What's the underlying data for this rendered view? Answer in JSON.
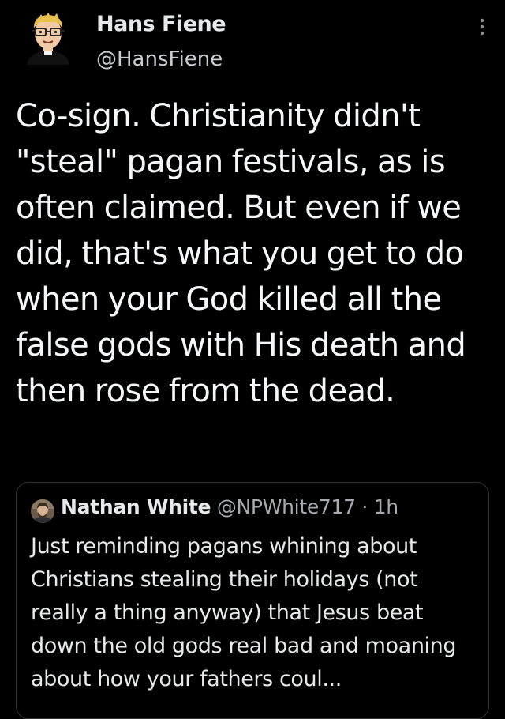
{
  "tweet": {
    "author_name": "Hans Fiene",
    "author_handle": "@HansFiene",
    "text": "Co-sign. Christianity didn't \"steal\" pagan festivals, as is often claimed. But even if we did, that's what you get to do when your God killed all the false gods with His death and then rose from the dead."
  },
  "quote": {
    "author_name": "Nathan White",
    "author_handle": "@NPWhite717",
    "separator": "·",
    "time": "1h",
    "text": "Just reminding pagans whining about Christians stealing their holidays (not really a thing anyway) that Jesus beat down the old gods real bad and moaning about how your fathers coul..."
  },
  "icons": {
    "more": "more-vertical-icon",
    "avatar": "cartoon-avatar-icon",
    "quote_avatar": "profile-photo-icon"
  },
  "colors": {
    "background": "#000000",
    "text": "#e7e9ea",
    "secondary_text": "#a8acb0",
    "border": "#2f3336"
  }
}
